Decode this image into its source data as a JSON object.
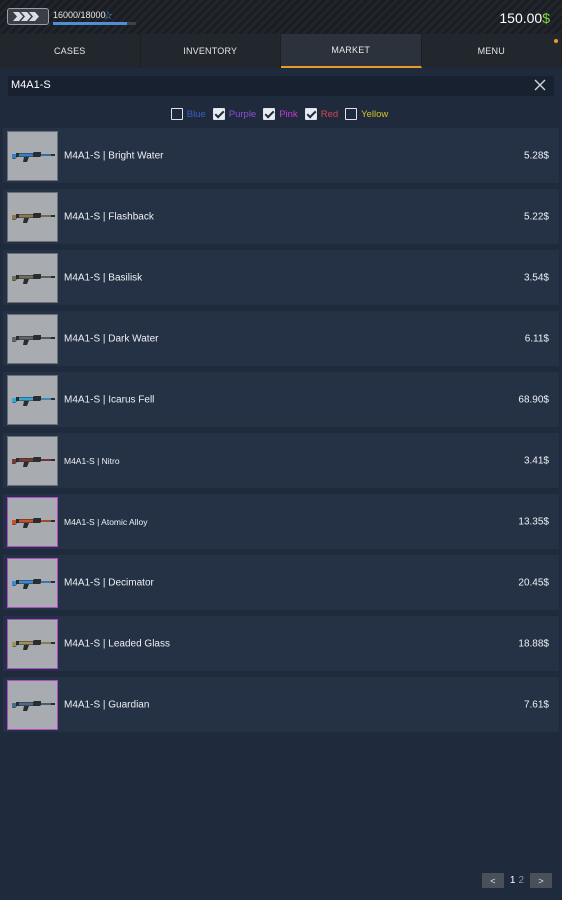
{
  "header": {
    "xp_text": "16000/18000",
    "xp_progress": 0.8889,
    "balance_value": "150.00",
    "balance_currency": "$",
    "rank_icon": "rank-badge-icon",
    "star_icon": "star-icon"
  },
  "tabs": [
    {
      "label": "CASES"
    },
    {
      "label": "INVENTORY"
    },
    {
      "label": "MARKET"
    },
    {
      "label": "MENU"
    }
  ],
  "search": {
    "value": "M4A1-S",
    "clear_icon": "close-icon"
  },
  "filters": [
    {
      "label": "Blue",
      "checked": false,
      "color": "#3a5ec2"
    },
    {
      "label": "Purple",
      "checked": true,
      "color": "#8a4fd6"
    },
    {
      "label": "Pink",
      "checked": true,
      "color": "#c83ad0"
    },
    {
      "label": "Red",
      "checked": true,
      "color": "#d34a4a"
    },
    {
      "label": "Yellow",
      "checked": false,
      "color": "#d8c22a"
    }
  ],
  "items": [
    {
      "name": "M4A1-S | Bright Water",
      "price": "5.28$",
      "color": "#3a7ec2"
    },
    {
      "name": "M4A1-S | Flashback",
      "price": "5.22$",
      "color": "#8a7a52"
    },
    {
      "name": "M4A1-S | Basilisk",
      "price": "3.54$",
      "color": "#6e6e5a"
    },
    {
      "name": "M4A1-S | Dark Water",
      "price": "6.11$",
      "color": "#5f6670"
    },
    {
      "name": "M4A1-S | Icarus Fell",
      "price": "68.90$",
      "color": "#3aa6d8"
    },
    {
      "name": "M4A1-S | Nitro",
      "price": "3.41$",
      "color": "#7a3a32"
    },
    {
      "name": "M4A1-S | Atomic Alloy",
      "price": "13.35$",
      "color": "#c8502a"
    },
    {
      "name": "M4A1-S | Decimator",
      "price": "20.45$",
      "color": "#3a8ad8"
    },
    {
      "name": "M4A1-S | Leaded Glass",
      "price": "18.88$",
      "color": "#a0905a"
    },
    {
      "name": "M4A1-S | Guardian",
      "price": "7.61$",
      "color": "#4a6a8a"
    }
  ],
  "pagination": {
    "prev_label": "<",
    "next_label": ">",
    "pages": [
      "1",
      "2"
    ],
    "current": "1"
  }
}
